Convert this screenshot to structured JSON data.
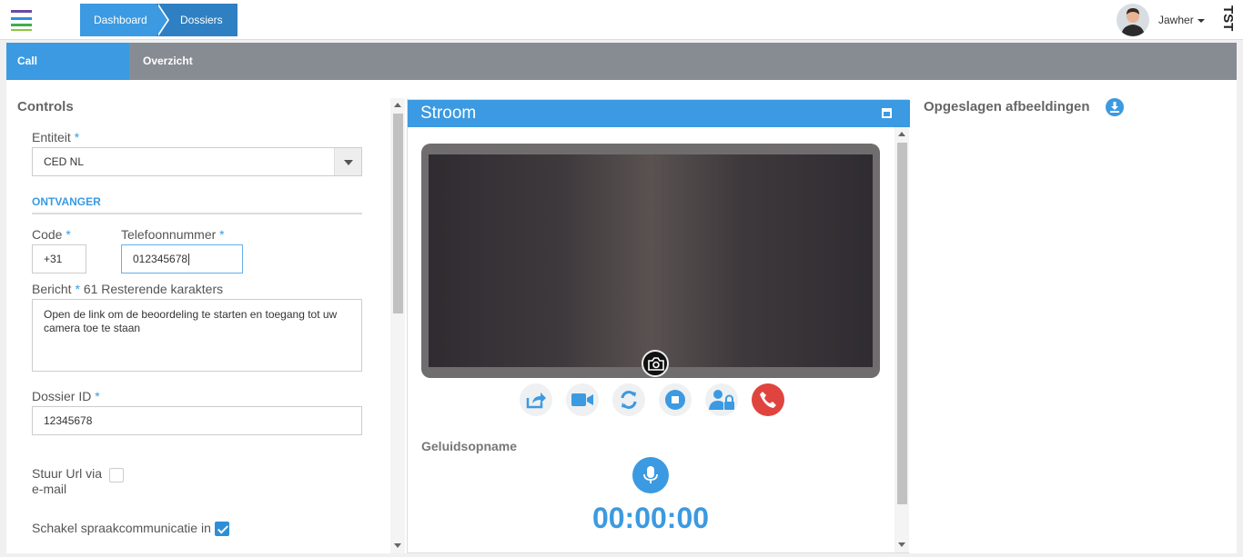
{
  "topbar": {
    "breadcrumbs": [
      "Dashboard",
      "Dossiers"
    ],
    "user_name": "Jawher",
    "env_label": "TST"
  },
  "tabs": [
    {
      "label": "Call",
      "active": true
    },
    {
      "label": "Overzicht",
      "active": false
    }
  ],
  "controls": {
    "title": "Controls",
    "entiteit_label": "Entiteit",
    "entiteit_value": "CED NL",
    "section_title": "ONTVANGER",
    "code_label": "Code",
    "code_value": "+31",
    "telefoon_label": "Telefoonnummer",
    "telefoon_value": "012345678",
    "bericht_label": "Bericht",
    "bericht_remaining": "61 Resterende karakters",
    "bericht_value": "Open de link om de beoordeling te starten en toegang tot uw camera toe te staan",
    "dossier_label": "Dossier ID",
    "dossier_value": "12345678",
    "stuur_url_label_1": "Stuur Url via",
    "stuur_url_label_2": "e-mail",
    "stuur_url_checked": false,
    "spraak_label": "Schakel spraakcommunicatie in",
    "spraak_checked": true,
    "required_mark": "*"
  },
  "stream": {
    "title": "Stroom",
    "audio_title": "Geluidsopname",
    "timer": "00:00:00",
    "buttons": [
      "share-icon",
      "video-camera-icon",
      "refresh-icon",
      "stop-icon",
      "user-lock-icon",
      "phone-hangup-icon"
    ]
  },
  "saved_images": {
    "title": "Opgeslagen afbeeldingen"
  },
  "colors": {
    "primary": "#3b9ae1",
    "tabbar": "#878c93",
    "danger": "#e0443e"
  }
}
